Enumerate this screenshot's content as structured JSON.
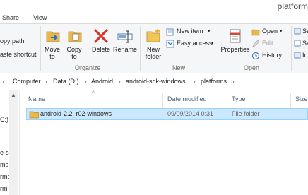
{
  "window": {
    "title": "platform"
  },
  "tabs": [
    {
      "label": "Share"
    },
    {
      "label": "View"
    }
  ],
  "ribbon": {
    "clipboard_partial": {
      "copy_path": "opy path",
      "paste_shortcut": "aste shortcut"
    },
    "organize": {
      "label": "Organize",
      "move_to": [
        "Move",
        "to"
      ],
      "copy_to": [
        "Copy",
        "to"
      ],
      "delete": "Delete",
      "rename": "Rename"
    },
    "new": {
      "label": "New",
      "new_folder": [
        "New",
        "folder"
      ],
      "new_item": "New item",
      "easy_access": "Easy access"
    },
    "open": {
      "label": "Open",
      "properties": "Properties",
      "open": "Open",
      "edit": "Edit",
      "history": "History"
    },
    "select_partial": {
      "s1": "Se",
      "s2": "Se",
      "s3": "In"
    }
  },
  "address": {
    "crumbs": [
      "Computer",
      "Data (D:)",
      "Android",
      "android-sdk-windows",
      "platforms"
    ]
  },
  "nav": {
    "items": [
      "C:)",
      "e-sd",
      "ms",
      "rms",
      "rm-s"
    ]
  },
  "columns": {
    "name": "Name",
    "date": "Date modified",
    "type": "Type",
    "size": "Size"
  },
  "rows": [
    {
      "name": "android-2.2_r02-windows",
      "date": "09/09/2014 0:31",
      "type": "File folder",
      "size": ""
    }
  ]
}
